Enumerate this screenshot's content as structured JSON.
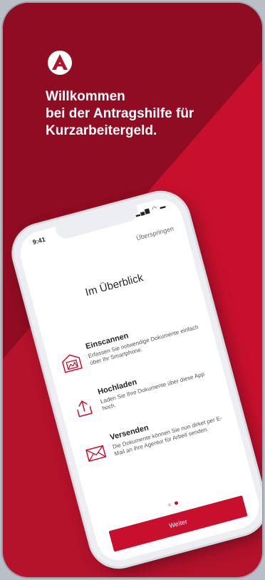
{
  "colors": {
    "brand_red": "#c8102e",
    "dark_red": "#8f0c22",
    "white": "#ffffff",
    "phone_frame": "#eceef1"
  },
  "logo": {
    "icon": "agentur-logo-icon"
  },
  "headline": {
    "line1": "Willkommen",
    "line2": "bei der Antragshilfe für",
    "line3": "Kurzarbeitergeld."
  },
  "phone": {
    "status": {
      "time": "9:41",
      "signal": "signal-icon",
      "wifi": "wifi-icon",
      "battery": "battery-icon"
    },
    "skip_label": "Überspringen",
    "title": "Im Überblick",
    "features": [
      {
        "title": "Einscannen",
        "desc": "Erfassen Sie notwendige Dokumente einfach über Ihr Smartphone.",
        "icon": "scan-icon"
      },
      {
        "title": "Hochladen",
        "desc": "Laden Sie Ihre Dokumente über diese App hoch.",
        "icon": "upload-icon"
      },
      {
        "title": "Versenden",
        "desc": "Die Dokumente können Sie nun dirket per E-Mail an ihre Agentur für Arbeit senden.",
        "icon": "mail-icon"
      }
    ],
    "pager": {
      "pages": 2,
      "current": 2
    },
    "next_label": "Weiter"
  }
}
